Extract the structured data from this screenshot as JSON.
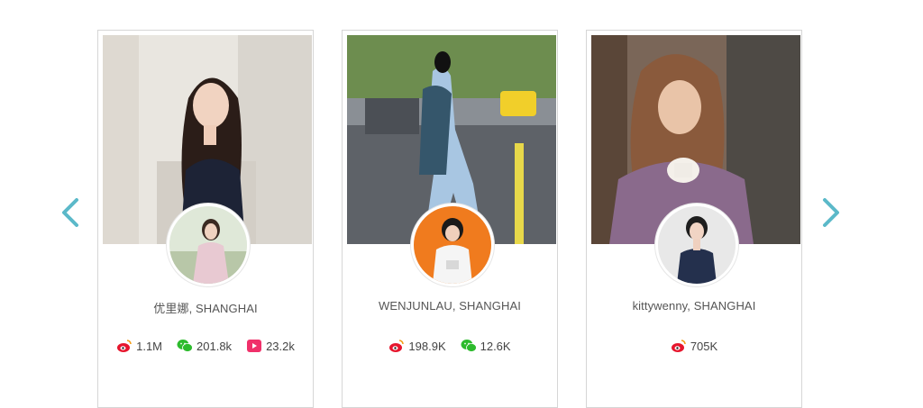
{
  "carousel": {
    "prev_icon": "chevron-left-icon",
    "next_icon": "chevron-right-icon",
    "arrow_color": "#5bb9c9"
  },
  "cards": [
    {
      "name": "优里娜, SHANGHAI",
      "stats": [
        {
          "icon": "weibo-icon",
          "value": "1.1M"
        },
        {
          "icon": "wechat-icon",
          "value": "201.8k"
        },
        {
          "icon": "video-icon",
          "value": "23.2k"
        }
      ]
    },
    {
      "name": "WENJUNLAU, SHANGHAI",
      "stats": [
        {
          "icon": "weibo-icon",
          "value": "198.9K"
        },
        {
          "icon": "wechat-icon",
          "value": "12.6K"
        }
      ]
    },
    {
      "name": "kittywenny, SHANGHAI",
      "stats": [
        {
          "icon": "weibo-icon",
          "value": "705K"
        }
      ]
    }
  ]
}
